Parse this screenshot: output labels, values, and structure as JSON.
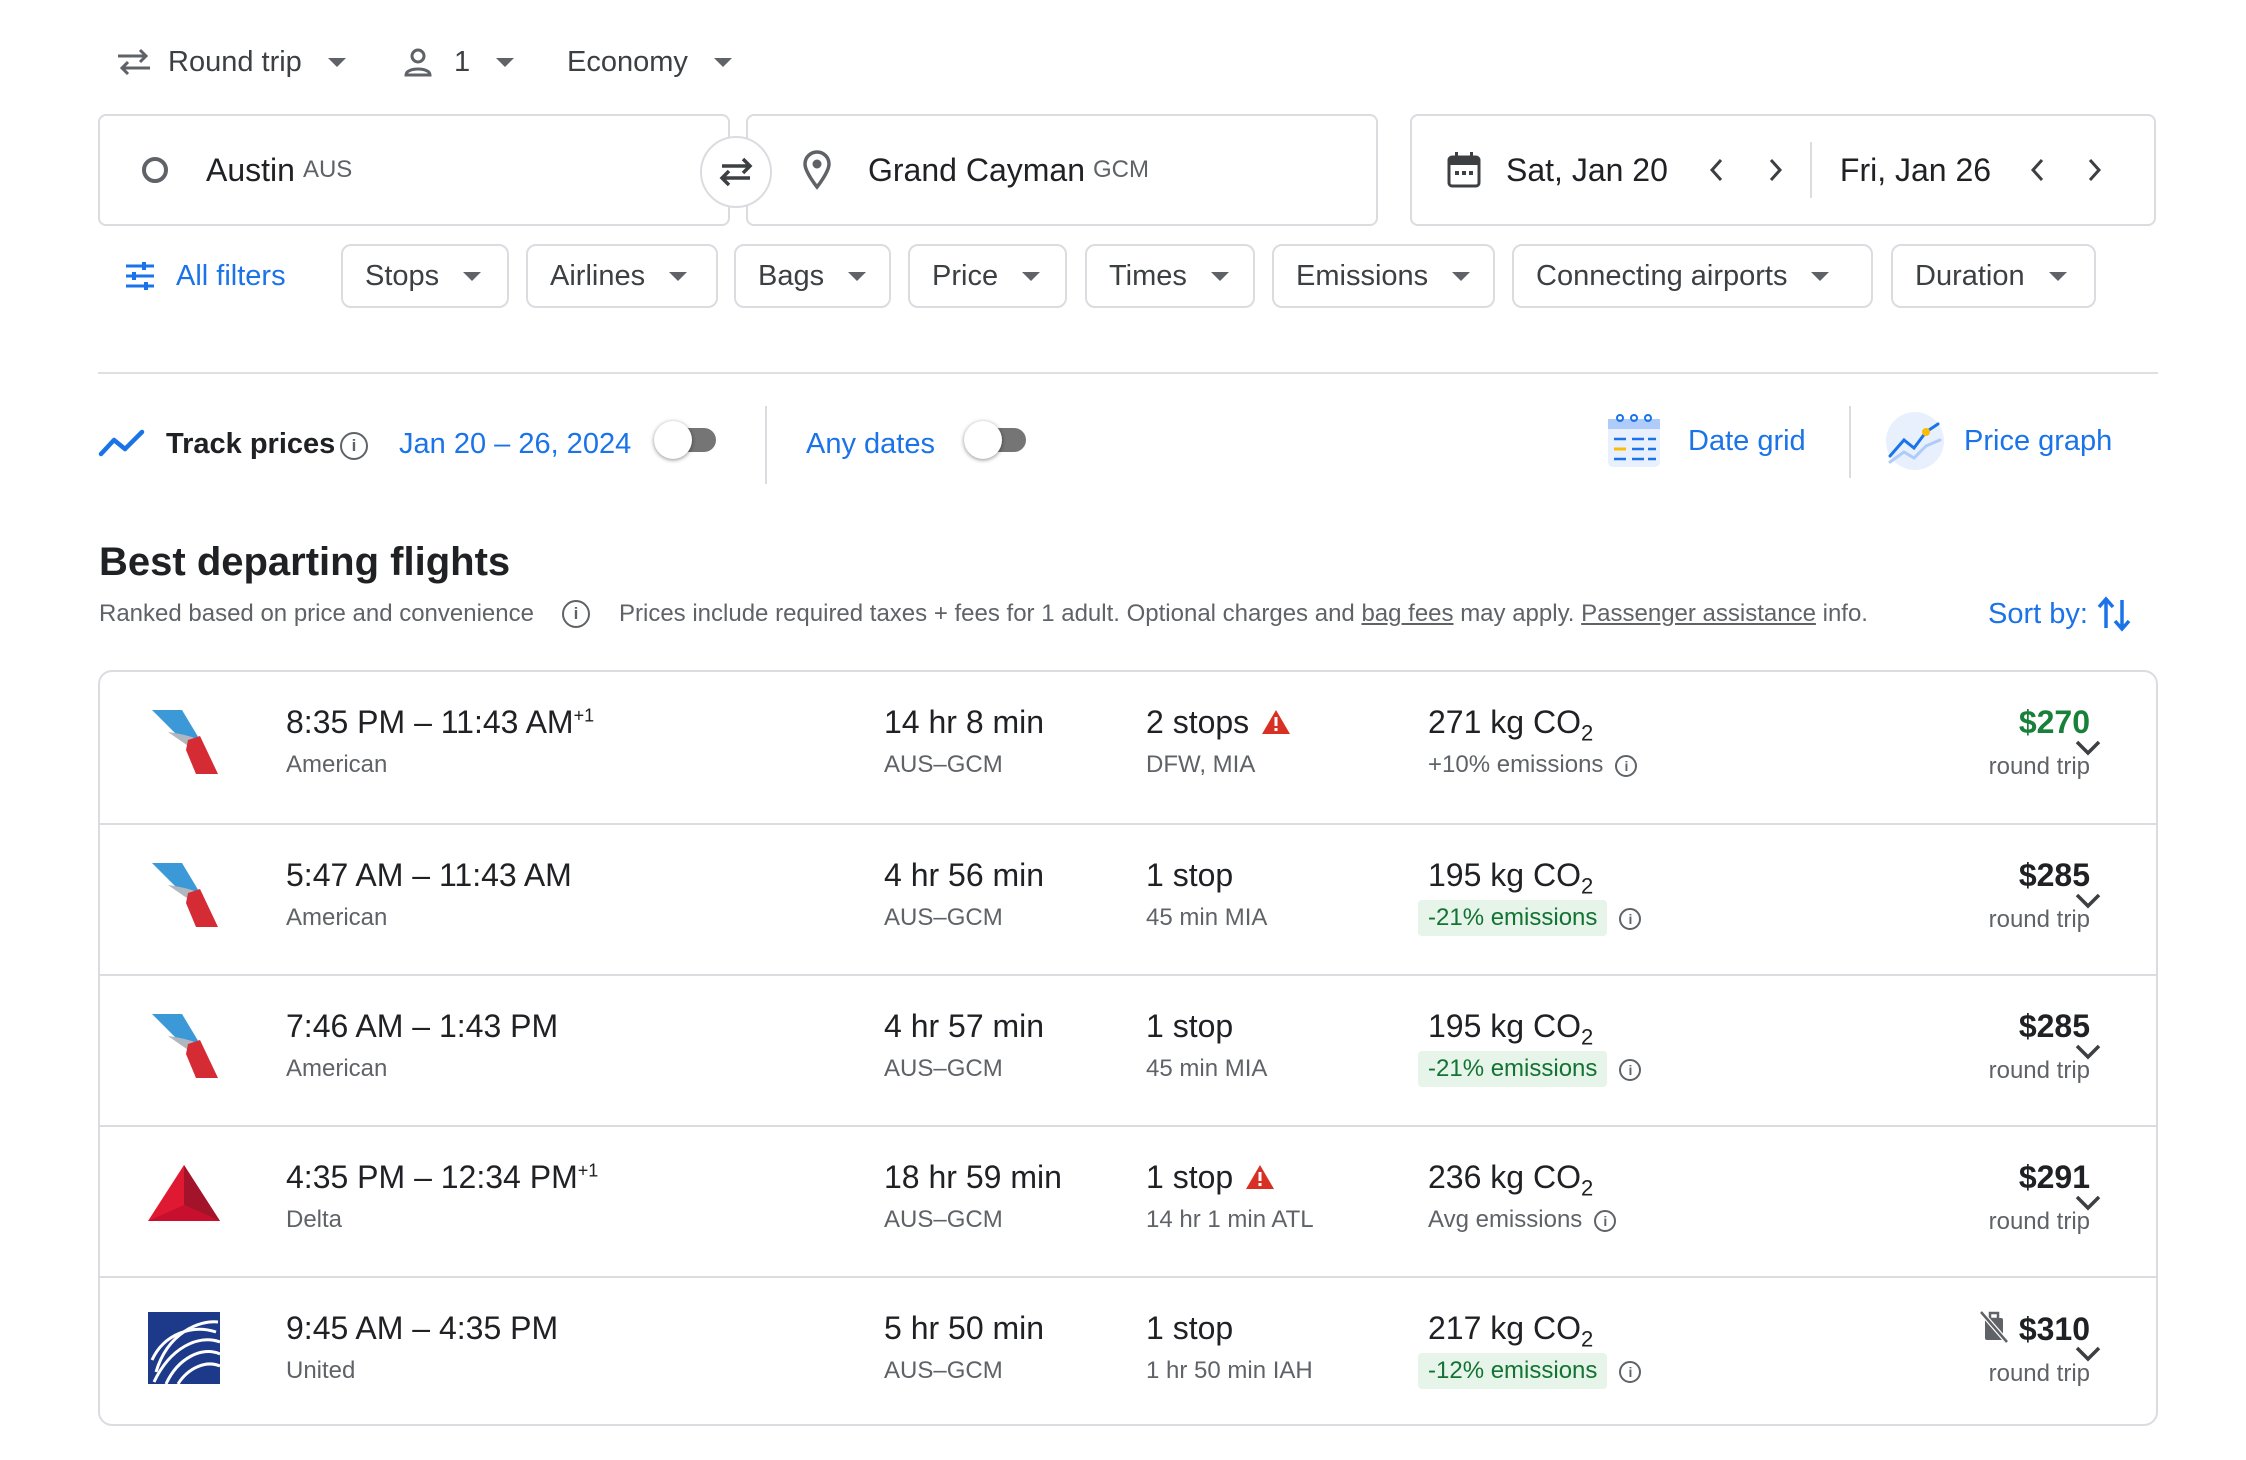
{
  "top": {
    "trip_type": "Round trip",
    "passengers": "1",
    "cabin": "Economy"
  },
  "search": {
    "origin_city": "Austin",
    "origin_code": "AUS",
    "dest_city": "Grand Cayman",
    "dest_code": "GCM",
    "depart_date": "Sat, Jan 20",
    "return_date": "Fri, Jan 26"
  },
  "filters": {
    "all_filters": "All filters",
    "chips": [
      "Stops",
      "Airlines",
      "Bags",
      "Price",
      "Times",
      "Emissions",
      "Connecting airports",
      "Duration"
    ]
  },
  "track": {
    "label": "Track prices",
    "range": "Jan 20 – 26, 2024",
    "any_dates": "Any dates",
    "date_grid": "Date grid",
    "price_graph": "Price graph"
  },
  "results": {
    "title": "Best departing flights",
    "ranked": "Ranked based on price and convenience",
    "prices_prefix": "Prices include required taxes + fees for 1 adult. Optional charges and",
    "bag_fees": "bag fees",
    "may_apply": "may apply.",
    "passenger_assistance": "Passenger assistance",
    "info": "info.",
    "sort_by": "Sort by:"
  },
  "flights": [
    {
      "times": "8:35 PM – 11:43 AM",
      "plus_day": "+1",
      "airline": "American",
      "duration": "14 hr 8 min",
      "route": "AUS–GCM",
      "stops": "2 stops",
      "stops_detail": "DFW, MIA",
      "warning": true,
      "co2": "271 kg CO",
      "co2_sub": "2",
      "emissions": "+10% emissions",
      "emissions_good": false,
      "price": "$270",
      "price_green": true,
      "price_note": "round trip",
      "logo": "american"
    },
    {
      "times": "5:47 AM – 11:43 AM",
      "plus_day": "",
      "airline": "American",
      "duration": "4 hr 56 min",
      "route": "AUS–GCM",
      "stops": "1 stop",
      "stops_detail": "45 min MIA",
      "warning": false,
      "co2": "195 kg CO",
      "co2_sub": "2",
      "emissions": "-21% emissions",
      "emissions_good": true,
      "price": "$285",
      "price_green": false,
      "price_note": "round trip",
      "logo": "american"
    },
    {
      "times": "7:46 AM – 1:43 PM",
      "plus_day": "",
      "airline": "American",
      "duration": "4 hr 57 min",
      "route": "AUS–GCM",
      "stops": "1 stop",
      "stops_detail": "45 min MIA",
      "warning": false,
      "co2": "195 kg CO",
      "co2_sub": "2",
      "emissions": "-21% emissions",
      "emissions_good": true,
      "price": "$285",
      "price_green": false,
      "price_note": "round trip",
      "logo": "american"
    },
    {
      "times": "4:35 PM – 12:34 PM",
      "plus_day": "+1",
      "airline": "Delta",
      "duration": "18 hr 59 min",
      "route": "AUS–GCM",
      "stops": "1 stop",
      "stops_detail": "14 hr 1 min ATL",
      "warning": true,
      "co2": "236 kg CO",
      "co2_sub": "2",
      "emissions": "Avg emissions",
      "emissions_good": false,
      "price": "$291",
      "price_green": false,
      "price_note": "round trip",
      "logo": "delta"
    },
    {
      "times": "9:45 AM – 4:35 PM",
      "plus_day": "",
      "airline": "United",
      "duration": "5 hr 50 min",
      "route": "AUS–GCM",
      "stops": "1 stop",
      "stops_detail": "1 hr 50 min IAH",
      "warning": false,
      "co2": "217 kg CO",
      "co2_sub": "2",
      "emissions": "-12% emissions",
      "emissions_good": true,
      "price": "$310",
      "price_green": false,
      "price_note": "round trip",
      "logo": "united",
      "no_bag_icon": true
    }
  ]
}
